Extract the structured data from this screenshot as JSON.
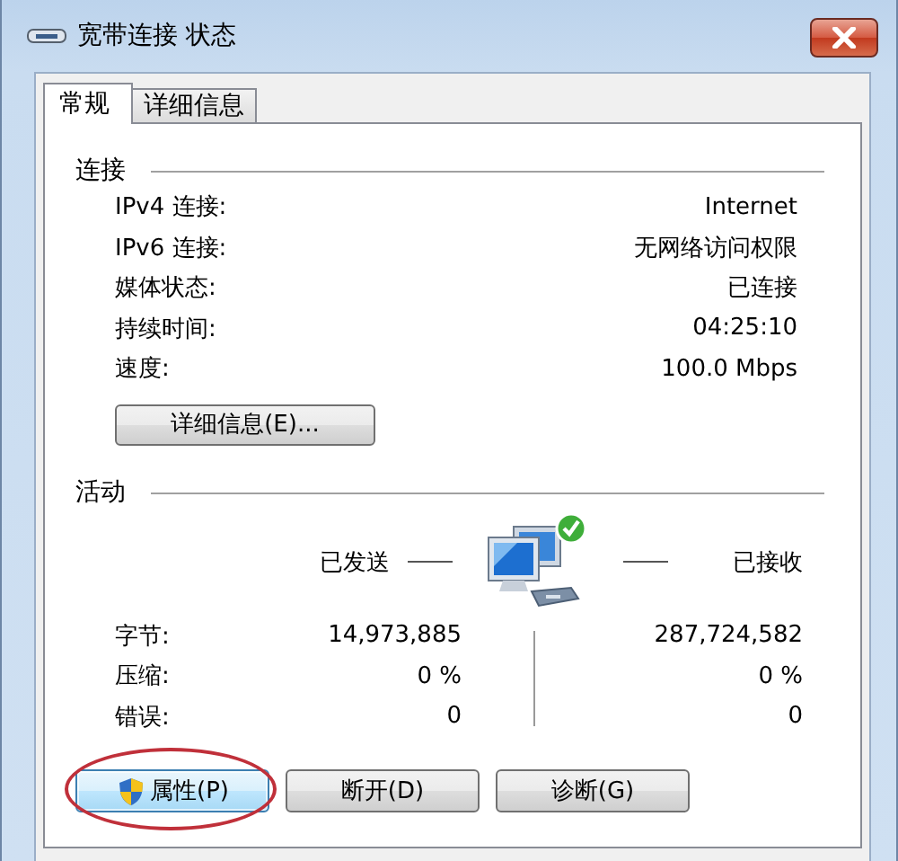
{
  "window": {
    "title": "宽带连接 状态"
  },
  "tabs": [
    {
      "label": "常规",
      "selected": true
    },
    {
      "label": "详细信息",
      "selected": false
    }
  ],
  "connection": {
    "heading": "连接",
    "rows": [
      {
        "label": "IPv4 连接:",
        "value": "Internet"
      },
      {
        "label": "IPv6 连接:",
        "value": "无网络访问权限"
      },
      {
        "label": "媒体状态:",
        "value": "已连接"
      },
      {
        "label": "持续时间:",
        "value": "04:25:10"
      },
      {
        "label": "速度:",
        "value": "100.0 Mbps"
      }
    ],
    "details_button": "详细信息(E)..."
  },
  "activity": {
    "heading": "活动",
    "sent_label": "已发送",
    "received_label": "已接收",
    "rows": [
      {
        "label": "字节:",
        "sent": "14,973,885",
        "received": "287,724,582"
      },
      {
        "label": "压缩:",
        "sent": "0 %",
        "received": "0 %"
      },
      {
        "label": "错误:",
        "sent": "0",
        "received": "0"
      }
    ]
  },
  "buttons": [
    {
      "label": "属性(P)",
      "kind": "shield",
      "focused": true,
      "circled": true
    },
    {
      "label": "断开(D)",
      "kind": "plain",
      "focused": false,
      "circled": false
    },
    {
      "label": "诊断(G)",
      "kind": "plain",
      "focused": false,
      "circled": false
    }
  ]
}
